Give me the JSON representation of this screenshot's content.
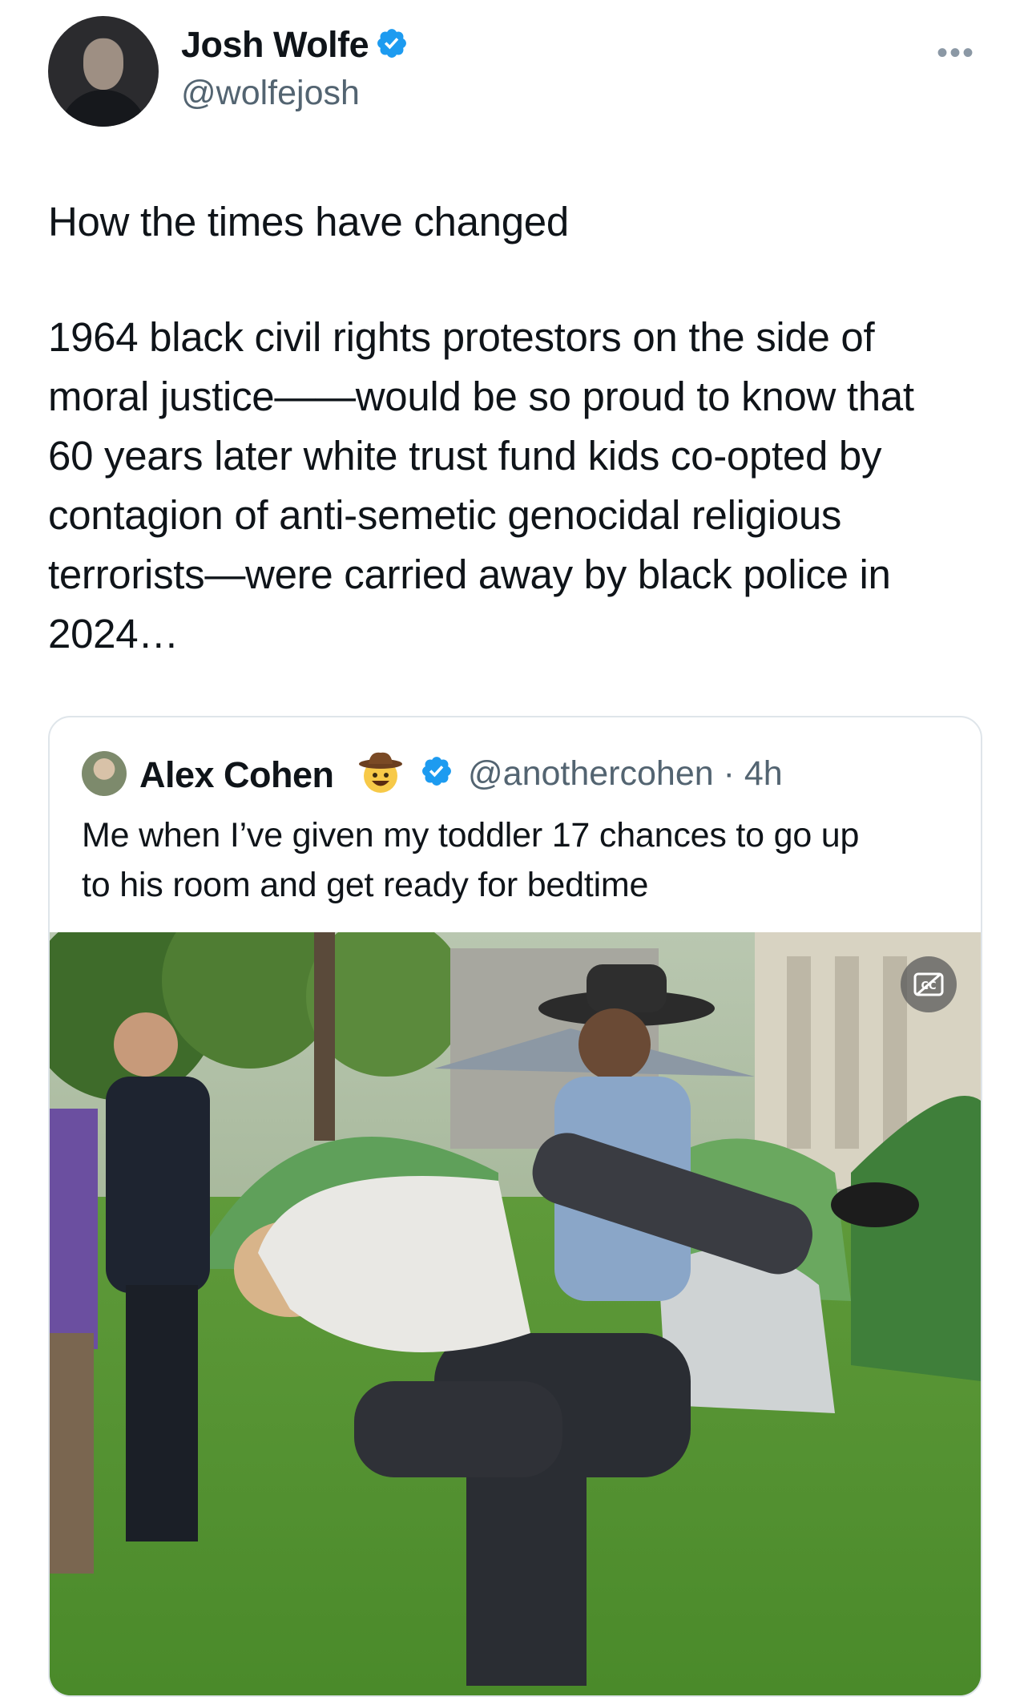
{
  "tweet": {
    "author": {
      "name": "Josh Wolfe",
      "handle": "@wolfejosh",
      "verified": true
    },
    "more_label": "•••",
    "text_lines": [
      "How the times have changed",
      "1964 black civil rights protestors on the side of",
      "moral justice——would be so proud to know that",
      "60 years later white trust fund kids co-opted by",
      "contagion of anti-semetic genocidal religious",
      "terrorists—were carried away by black police in",
      "2024…"
    ]
  },
  "quote": {
    "author": {
      "name": "Alex Cohen",
      "emoji": "cowboy-hat-face",
      "verified": true,
      "handle_time": "@anothercohen · 4h"
    },
    "text_lines": [
      "Me when I’ve given my toddler 17 chances to go up",
      "to his room and get ready for bedtime"
    ],
    "media": {
      "type": "video",
      "cc_icon": "closed-captions-off-icon"
    }
  },
  "colors": {
    "text": "#0f1419",
    "secondary": "#536471",
    "verified_blue": "#1d9bf0",
    "border": "#dfe5ea"
  }
}
